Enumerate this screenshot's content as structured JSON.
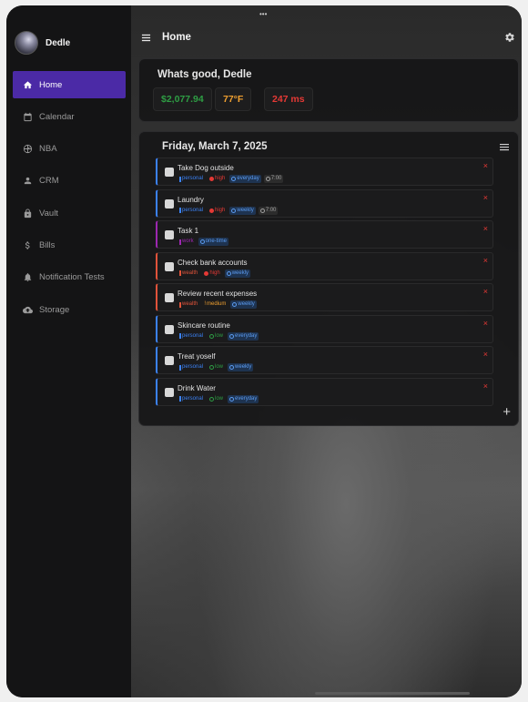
{
  "profile": {
    "name": "Dedle"
  },
  "nav": [
    {
      "label": "Home",
      "icon": "home-icon",
      "active": true
    },
    {
      "label": "Calendar",
      "icon": "calendar-icon"
    },
    {
      "label": "NBA",
      "icon": "basketball-icon"
    },
    {
      "label": "CRM",
      "icon": "person-icon"
    },
    {
      "label": "Vault",
      "icon": "lock-icon"
    },
    {
      "label": "Bills",
      "icon": "dollar-icon"
    },
    {
      "label": "Notification Tests",
      "icon": "bell-icon"
    },
    {
      "label": "Storage",
      "icon": "cloud-icon"
    }
  ],
  "header": {
    "title": "Home",
    "grabber": "•••"
  },
  "greeting": {
    "title": "Whats good, Dedle",
    "stats": [
      {
        "name": "balance",
        "value": "$2,077.94",
        "color": "#2e9e44"
      },
      {
        "name": "temperature",
        "value": "77°F",
        "color": "#f0a030"
      },
      {
        "name": "latency",
        "value": "247 ms",
        "color": "#e53935"
      }
    ]
  },
  "tasks": {
    "date": "Friday, March 7, 2025",
    "add_label": "+",
    "delete_label": "×",
    "items": [
      {
        "title": "Take Dog outside",
        "accent": "#3b82f6",
        "category": "personal",
        "category_color": "#3b82f6",
        "priority": "high",
        "priority_color": "#e53935",
        "recurrence": "everyday",
        "time": "7:00"
      },
      {
        "title": "Laundry",
        "accent": "#3b82f6",
        "category": "personal",
        "category_color": "#3b82f6",
        "priority": "high",
        "priority_color": "#e53935",
        "recurrence": "weekly",
        "time": "7:00"
      },
      {
        "title": "Task 1",
        "accent": "#9c27b0",
        "category": "work",
        "category_color": "#9c27b0",
        "priority": "",
        "priority_color": "",
        "recurrence": "one-time",
        "time": ""
      },
      {
        "title": "Check bank accounts",
        "accent": "#e0533a",
        "category": "wealth",
        "category_color": "#e0533a",
        "priority": "high",
        "priority_color": "#e53935",
        "recurrence": "weekly",
        "time": ""
      },
      {
        "title": "Review recent expenses",
        "accent": "#e0533a",
        "category": "wealth",
        "category_color": "#e0533a",
        "priority": "medium",
        "priority_color": "#f0a030",
        "recurrence": "weekly",
        "time": ""
      },
      {
        "title": "Skincare routine",
        "accent": "#3b82f6",
        "category": "personal",
        "category_color": "#3b82f6",
        "priority": "low",
        "priority_color": "#2e9e44",
        "recurrence": "everyday",
        "time": ""
      },
      {
        "title": "Treat yoself",
        "accent": "#3b82f6",
        "category": "personal",
        "category_color": "#3b82f6",
        "priority": "low",
        "priority_color": "#2e9e44",
        "recurrence": "weekly",
        "time": ""
      },
      {
        "title": "Drink Water",
        "accent": "#3b82f6",
        "category": "personal",
        "category_color": "#3b82f6",
        "priority": "low",
        "priority_color": "#2e9e44",
        "recurrence": "everyday",
        "time": ""
      }
    ]
  }
}
